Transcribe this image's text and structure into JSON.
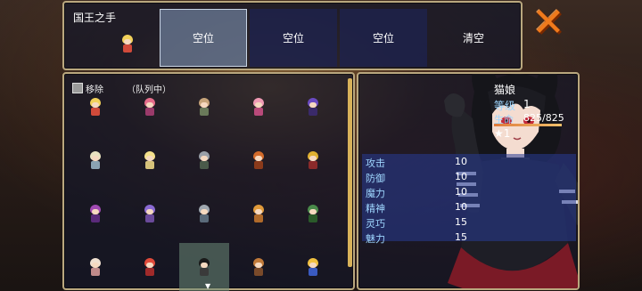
{
  "top": {
    "title": "国王之手",
    "slots": [
      "空位",
      "空位",
      "空位",
      "清空"
    ],
    "close_icon": "close-x-icon",
    "close_color": "#f07a1c"
  },
  "roster": {
    "remove_label": "移除",
    "queue_label": "（队列中）",
    "cells": [
      {
        "hair": "#f2d15a",
        "outfit": "#d14a3a"
      },
      {
        "hair": "#e56c8a",
        "outfit": "#9a3a6a"
      },
      {
        "hair": "#c7a47a",
        "outfit": "#6a7a5a"
      },
      {
        "hair": "#f09ab4",
        "outfit": "#b94a7a"
      },
      {
        "hair": "#6a4ac2",
        "outfit": "#3a2a6a"
      },
      {
        "hair": "#e8e2c0",
        "outfit": "#8aa2b2"
      },
      {
        "hair": "#f4e08a",
        "outfit": "#d6c27a"
      },
      {
        "hair": "#9aa0a8",
        "outfit": "#4a5a4a"
      },
      {
        "hair": "#d26a2a",
        "outfit": "#8a3a1a"
      },
      {
        "hair": "#e0b030",
        "outfit": "#8a2a2a"
      },
      {
        "hair": "#a04ab2",
        "outfit": "#5a2a7a"
      },
      {
        "hair": "#8a6ad2",
        "outfit": "#6a4a9a"
      },
      {
        "hair": "#a0a8b0",
        "outfit": "#5a6a7a"
      },
      {
        "hair": "#e09a3a",
        "outfit": "#b06a2a"
      },
      {
        "hair": "#4a8a4a",
        "outfit": "#2a5a2a"
      },
      {
        "hair": "#f0e0d0",
        "outfit": "#c08a8a"
      },
      {
        "hair": "#e04a3a",
        "outfit": "#a02a2a"
      },
      {
        "hair": "#1a1a1a",
        "outfit": "#3a3a3a"
      },
      {
        "hair": "#c07a3a",
        "outfit": "#7a4a2a"
      },
      {
        "hair": "#f0c040",
        "outfit": "#3a5ac0"
      }
    ],
    "selected_index": 17,
    "scroll_icon": "scroll-down-arrow-icon"
  },
  "character": {
    "name": "猫娘",
    "level_label": "等级",
    "level": "1",
    "hp_label": "生命",
    "hp": "825/825",
    "hp_fraction": 1.0,
    "stars": "★1",
    "stats": [
      {
        "label": "攻击",
        "value": "10"
      },
      {
        "label": "防御",
        "value": "10"
      },
      {
        "label": "魔力",
        "value": "10"
      },
      {
        "label": "精神",
        "value": "10"
      },
      {
        "label": "灵巧",
        "value": "15"
      },
      {
        "label": "魅力",
        "value": "15"
      }
    ]
  }
}
